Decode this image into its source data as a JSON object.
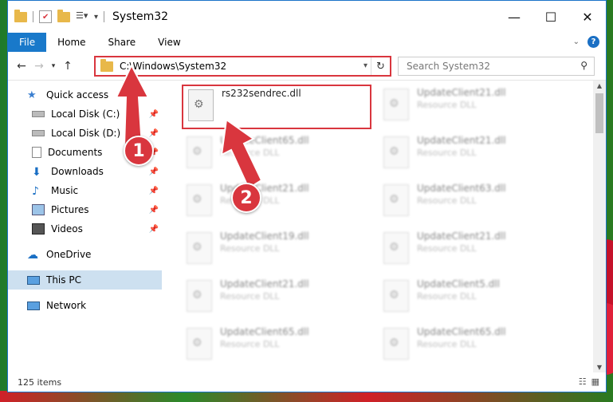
{
  "window": {
    "title": "System32"
  },
  "ribbon": {
    "tabs": [
      "File",
      "Home",
      "Share",
      "View"
    ],
    "help": "?"
  },
  "address": {
    "path": "C:\\Windows\\System32"
  },
  "search": {
    "placeholder": "Search System32"
  },
  "sidebar": {
    "items": [
      {
        "label": "Quick access",
        "icon": "star-icon"
      },
      {
        "label": "Local Disk (C:)",
        "icon": "drive-icon"
      },
      {
        "label": "Local Disk (D:)",
        "icon": "drive-icon"
      },
      {
        "label": "Documents",
        "icon": "documents-icon"
      },
      {
        "label": "Downloads",
        "icon": "download-icon"
      },
      {
        "label": "Music",
        "icon": "music-icon"
      },
      {
        "label": "Pictures",
        "icon": "pictures-icon"
      },
      {
        "label": "Videos",
        "icon": "videos-icon"
      },
      {
        "label": "OneDrive",
        "icon": "cloud-icon"
      },
      {
        "label": "This PC",
        "icon": "computer-icon"
      },
      {
        "label": "Network",
        "icon": "network-icon"
      }
    ]
  },
  "files": [
    {
      "name": "rs232sendrec.dll",
      "type": ""
    },
    {
      "name": "UpdateClient21.dll",
      "type": "Resource DLL"
    },
    {
      "name": "UpdateClient65.dll",
      "type": "Resource DLL"
    },
    {
      "name": "UpdateClient21.dll",
      "type": "Resource DLL"
    },
    {
      "name": "UpdateClient21.dll",
      "type": "Resource DLL"
    },
    {
      "name": "UpdateClient63.dll",
      "type": "Resource DLL"
    },
    {
      "name": "UpdateClient19.dll",
      "type": "Resource DLL"
    },
    {
      "name": "UpdateClient21.dll",
      "type": "Resource DLL"
    },
    {
      "name": "UpdateClient21.dll",
      "type": "Resource DLL"
    },
    {
      "name": "UpdateClient5.dll",
      "type": "Resource DLL"
    },
    {
      "name": "UpdateClient65.dll",
      "type": "Resource DLL"
    },
    {
      "name": "UpdateClient65.dll",
      "type": "Resource DLL"
    }
  ],
  "status": {
    "item_count": "125 items"
  },
  "callouts": {
    "one": "1",
    "two": "2"
  },
  "colors": {
    "accent": "#1979ca",
    "highlight": "#d9363e"
  }
}
